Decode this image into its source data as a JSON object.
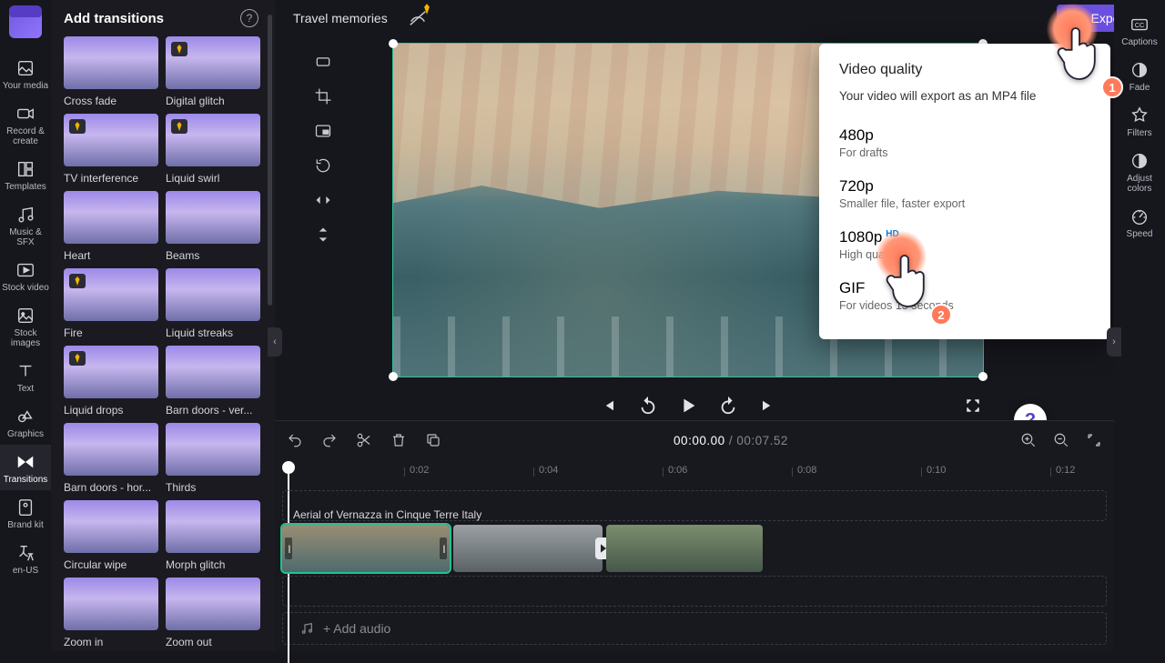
{
  "project": {
    "title": "Travel memories"
  },
  "export_button": "Export",
  "left_rail": [
    {
      "icon": "media",
      "label": "Your media"
    },
    {
      "icon": "record",
      "label": "Record & create"
    },
    {
      "icon": "templates",
      "label": "Templates"
    },
    {
      "icon": "music",
      "label": "Music & SFX"
    },
    {
      "icon": "stockvid",
      "label": "Stock video"
    },
    {
      "icon": "stockimg",
      "label": "Stock images"
    },
    {
      "icon": "text",
      "label": "Text"
    },
    {
      "icon": "graphics",
      "label": "Graphics"
    },
    {
      "icon": "transitions",
      "label": "Transitions",
      "active": true
    },
    {
      "icon": "brandkit",
      "label": "Brand kit"
    },
    {
      "icon": "lang",
      "label": "en-US"
    }
  ],
  "right_rail": [
    {
      "icon": "captions",
      "label": "Captions"
    },
    {
      "icon": "fade",
      "label": "Fade"
    },
    {
      "icon": "filters",
      "label": "Filters"
    },
    {
      "icon": "adjust",
      "label": "Adjust colors"
    },
    {
      "icon": "speed",
      "label": "Speed"
    }
  ],
  "transitions_panel": {
    "title": "Add transitions",
    "items": [
      {
        "label": "Cross fade",
        "premium": false
      },
      {
        "label": "Digital glitch",
        "premium": true
      },
      {
        "label": "TV interference",
        "premium": true
      },
      {
        "label": "Liquid swirl",
        "premium": true
      },
      {
        "label": "Heart",
        "premium": false
      },
      {
        "label": "Beams",
        "premium": false
      },
      {
        "label": "Fire",
        "premium": true
      },
      {
        "label": "Liquid streaks",
        "premium": false
      },
      {
        "label": "Liquid drops",
        "premium": true
      },
      {
        "label": "Barn doors - ver...",
        "premium": false
      },
      {
        "label": "Barn doors - hor...",
        "premium": false
      },
      {
        "label": "Thirds",
        "premium": false
      },
      {
        "label": "Circular wipe",
        "premium": false
      },
      {
        "label": "Morph glitch",
        "premium": false
      },
      {
        "label": "Zoom in",
        "premium": false
      },
      {
        "label": "Zoom out",
        "premium": false
      }
    ]
  },
  "export_popup": {
    "title": "Video quality",
    "subtitle": "Your video will export as an MP4 file",
    "options": [
      {
        "head": "480p",
        "sub": "For drafts"
      },
      {
        "head": "720p",
        "sub": "Smaller file, faster export"
      },
      {
        "head": "1080p",
        "sub": "High quality",
        "hd": true
      },
      {
        "head": "GIF",
        "sub": "For videos 15 seconds"
      }
    ]
  },
  "timeline": {
    "current": "00:00.00",
    "duration": "00:07.52",
    "ticks": [
      "0:02",
      "0:04",
      "0:06",
      "0:08",
      "0:10",
      "0:12"
    ],
    "clip_label": "Aerial of Vernazza in Cinque Terre Italy",
    "add_audio": "+ Add audio"
  },
  "tutorial": {
    "step1": "1",
    "step2": "2"
  }
}
